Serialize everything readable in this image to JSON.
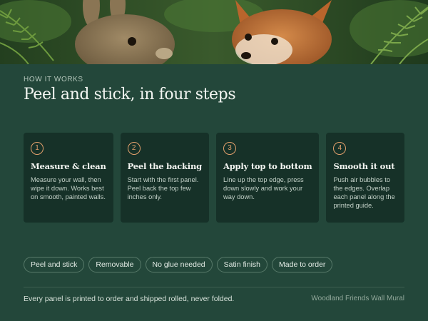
{
  "header": {
    "eyebrow": "HOW IT WORKS",
    "title": "Peel and stick, in four steps"
  },
  "steps": [
    {
      "number": "1",
      "title": "Measure & clean",
      "body": "Measure your wall, then wipe it down. Works best on smooth, painted walls."
    },
    {
      "number": "2",
      "title": "Peel the backing",
      "body": "Start with the first panel. Peel back the top few inches only."
    },
    {
      "number": "3",
      "title": "Apply top to bottom",
      "body": "Line up the top edge, press down slowly and work your way down."
    },
    {
      "number": "4",
      "title": "Smooth it out",
      "body": "Push air bubbles to the edges. Overlap each panel along the printed guide."
    }
  ],
  "tags": [
    "Peel and stick",
    "Removable",
    "No glue needed",
    "Satin finish",
    "Made to order"
  ],
  "footer": {
    "note": "Every panel is printed to order and shipped rolled, never folded.",
    "brand": "Woodland Friends Wall Mural"
  },
  "colors": {
    "background": "#23473a",
    "card": "#163128",
    "accent": "#e2a06c",
    "tag_border": "#587a6a"
  }
}
